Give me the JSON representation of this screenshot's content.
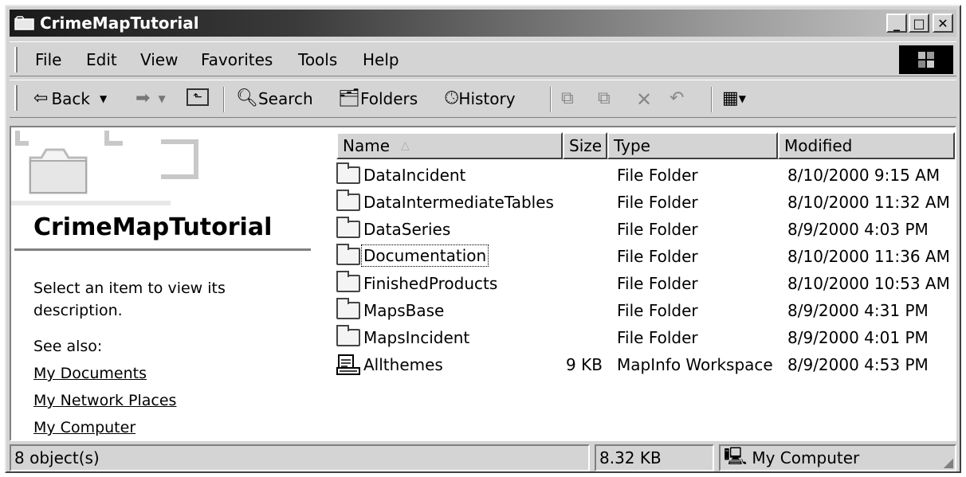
{
  "window": {
    "title": "CrimeMapTutorial",
    "controls": {
      "minimize": "_",
      "maximize": "□",
      "close": "✕"
    }
  },
  "menu": [
    "File",
    "Edit",
    "View",
    "Favorites",
    "Tools",
    "Help"
  ],
  "toolbar": {
    "back": "Back",
    "search": "Search",
    "folders": "Folders",
    "history": "History"
  },
  "left_pane": {
    "title": "CrimeMapTutorial",
    "description": "Select an item to view its description.",
    "see_also": "See also:",
    "links": [
      "My Documents",
      "My Network Places",
      "My Computer"
    ]
  },
  "columns": {
    "name": "Name",
    "size": "Size",
    "type": "Type",
    "modified": "Modified"
  },
  "files": [
    {
      "name": "DataIncident",
      "size": "",
      "type": "File Folder",
      "modified": "8/10/2000 9:15 AM",
      "kind": "folder"
    },
    {
      "name": "DataIntermediateTables",
      "size": "",
      "type": "File Folder",
      "modified": "8/10/2000 11:32 AM",
      "kind": "folder"
    },
    {
      "name": "DataSeries",
      "size": "",
      "type": "File Folder",
      "modified": "8/9/2000 4:03 PM",
      "kind": "folder"
    },
    {
      "name": "Documentation",
      "size": "",
      "type": "File Folder",
      "modified": "8/10/2000 11:36 AM",
      "kind": "folder",
      "focused": true
    },
    {
      "name": "FinishedProducts",
      "size": "",
      "type": "File Folder",
      "modified": "8/10/2000 10:53 AM",
      "kind": "folder"
    },
    {
      "name": "MapsBase",
      "size": "",
      "type": "File Folder",
      "modified": "8/9/2000 4:31 PM",
      "kind": "folder"
    },
    {
      "name": "MapsIncident",
      "size": "",
      "type": "File Folder",
      "modified": "8/9/2000 4:01 PM",
      "kind": "folder"
    },
    {
      "name": "Allthemes",
      "size": "9 KB",
      "type": "MapInfo Workspace",
      "modified": "8/9/2000 4:53 PM",
      "kind": "workspace"
    }
  ],
  "status": {
    "count": "8 object(s)",
    "size": "8.32 KB",
    "location": "My Computer"
  }
}
